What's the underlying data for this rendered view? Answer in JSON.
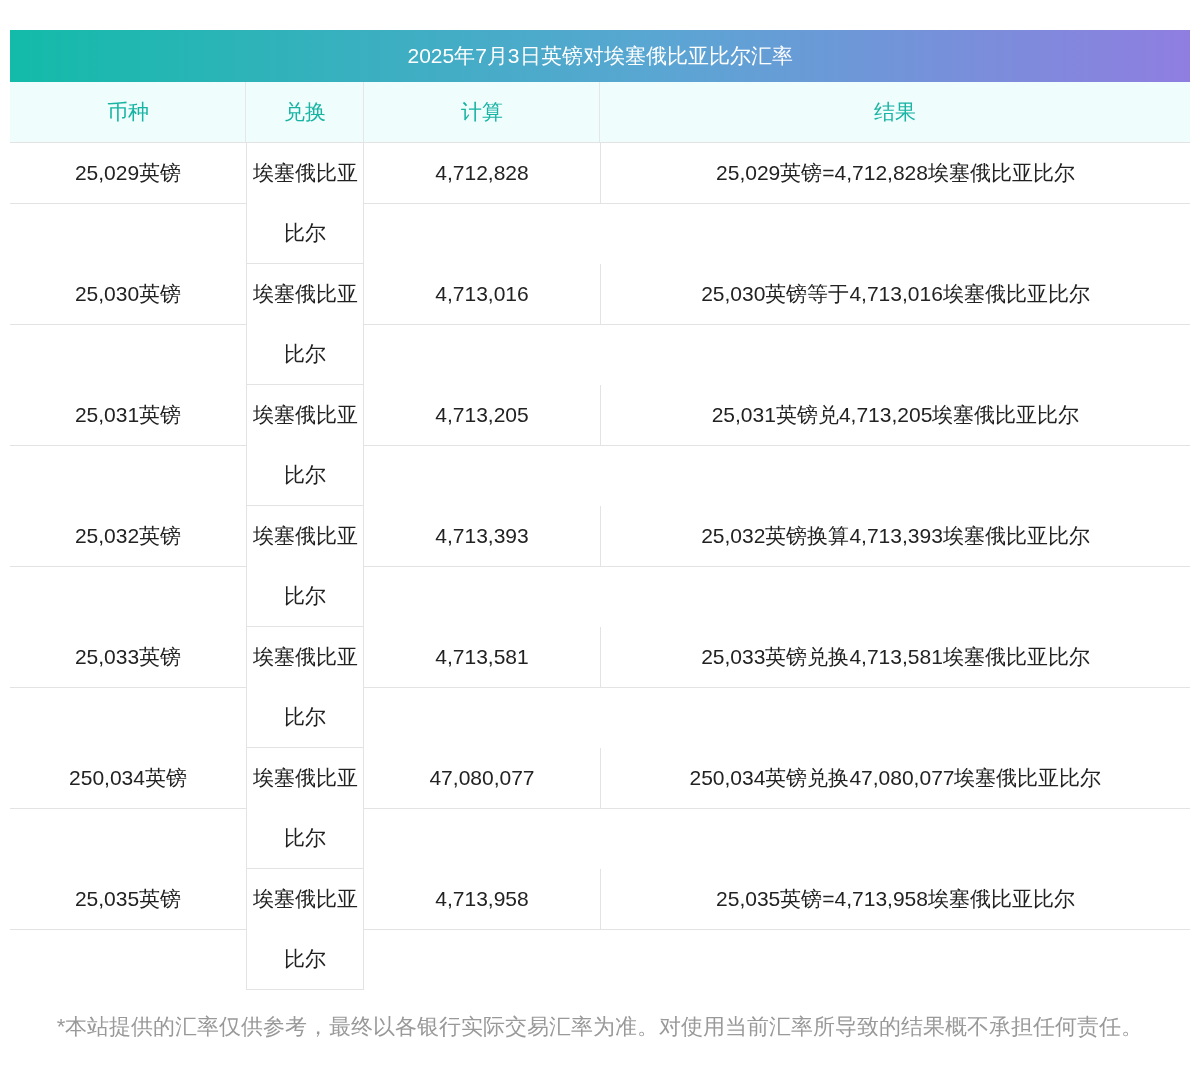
{
  "title": "2025年7月3日英镑对埃塞俄比亚比尔汇率",
  "columns": [
    "币种",
    "兑换",
    "计算",
    "结果"
  ],
  "rows": [
    {
      "currency": "25,029英镑",
      "exchange": "埃塞俄比亚比尔",
      "amount": "4,712,828",
      "result": "25,029英镑=4,712,828埃塞俄比亚比尔"
    },
    {
      "currency": "25,030英镑",
      "exchange": "埃塞俄比亚比尔",
      "amount": "4,713,016",
      "result": "25,030英镑等于4,713,016埃塞俄比亚比尔"
    },
    {
      "currency": "25,031英镑",
      "exchange": "埃塞俄比亚比尔",
      "amount": "4,713,205",
      "result": "25,031英镑兑4,713,205埃塞俄比亚比尔"
    },
    {
      "currency": "25,032英镑",
      "exchange": "埃塞俄比亚比尔",
      "amount": "4,713,393",
      "result": "25,032英镑换算4,713,393埃塞俄比亚比尔"
    },
    {
      "currency": "25,033英镑",
      "exchange": "埃塞俄比亚比尔",
      "amount": "4,713,581",
      "result": "25,033英镑兑换4,713,581埃塞俄比亚比尔"
    },
    {
      "currency": "250,034英镑",
      "exchange": "埃塞俄比亚比尔",
      "amount": "47,080,077",
      "result": "250,034英镑兑换47,080,077埃塞俄比亚比尔"
    },
    {
      "currency": "25,035英镑",
      "exchange": "埃塞俄比亚比尔",
      "amount": "4,713,958",
      "result": "25,035英镑=4,713,958埃塞俄比亚比尔"
    }
  ],
  "footnote": "*本站提供的汇率仅供参考，最终以各银行实际交易汇率为准。对使用当前汇率所导致的结果概不承担任何责任。"
}
